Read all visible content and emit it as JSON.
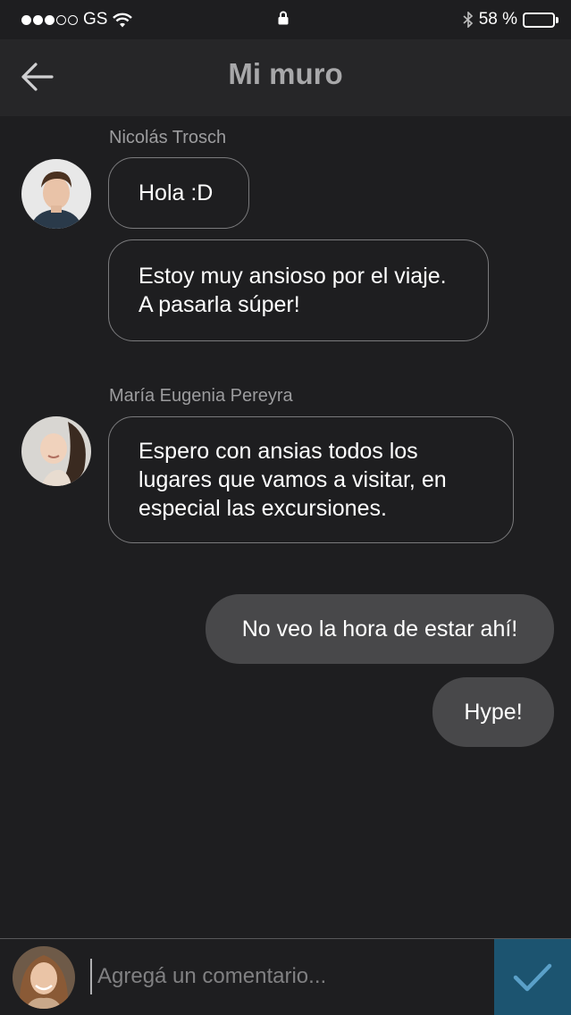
{
  "status_bar": {
    "carrier": "GS",
    "battery_percent": "58 %",
    "battery_level": 0.58,
    "icons": [
      "signal-dots-icon",
      "wifi-icon",
      "lock-icon",
      "bluetooth-icon",
      "battery-icon"
    ]
  },
  "nav": {
    "title": "Mi muro",
    "back_icon": "back-arrow-icon"
  },
  "messages": [
    {
      "sender": "Nicolás Trosch",
      "bubbles": [
        "Hola :D",
        "Estoy muy ansioso por el viaje.\nA pasarla súper!"
      ]
    },
    {
      "sender": "María Eugenia Pereyra",
      "bubbles": [
        "Espero con ansias todos los\nlugares que vamos a visitar, en\nespecial las excursiones."
      ]
    }
  ],
  "own_messages": [
    "No veo la hora de estar ahí!",
    "Hype!"
  ],
  "composer": {
    "placeholder": "Agregá un comentario...",
    "send_icon": "checkmark-icon"
  },
  "colors": {
    "background": "#1e1e20",
    "nav_background": "#262628",
    "own_bubble": "#48484a",
    "send_button": "#1c5470",
    "send_check": "#5aa0c8"
  }
}
